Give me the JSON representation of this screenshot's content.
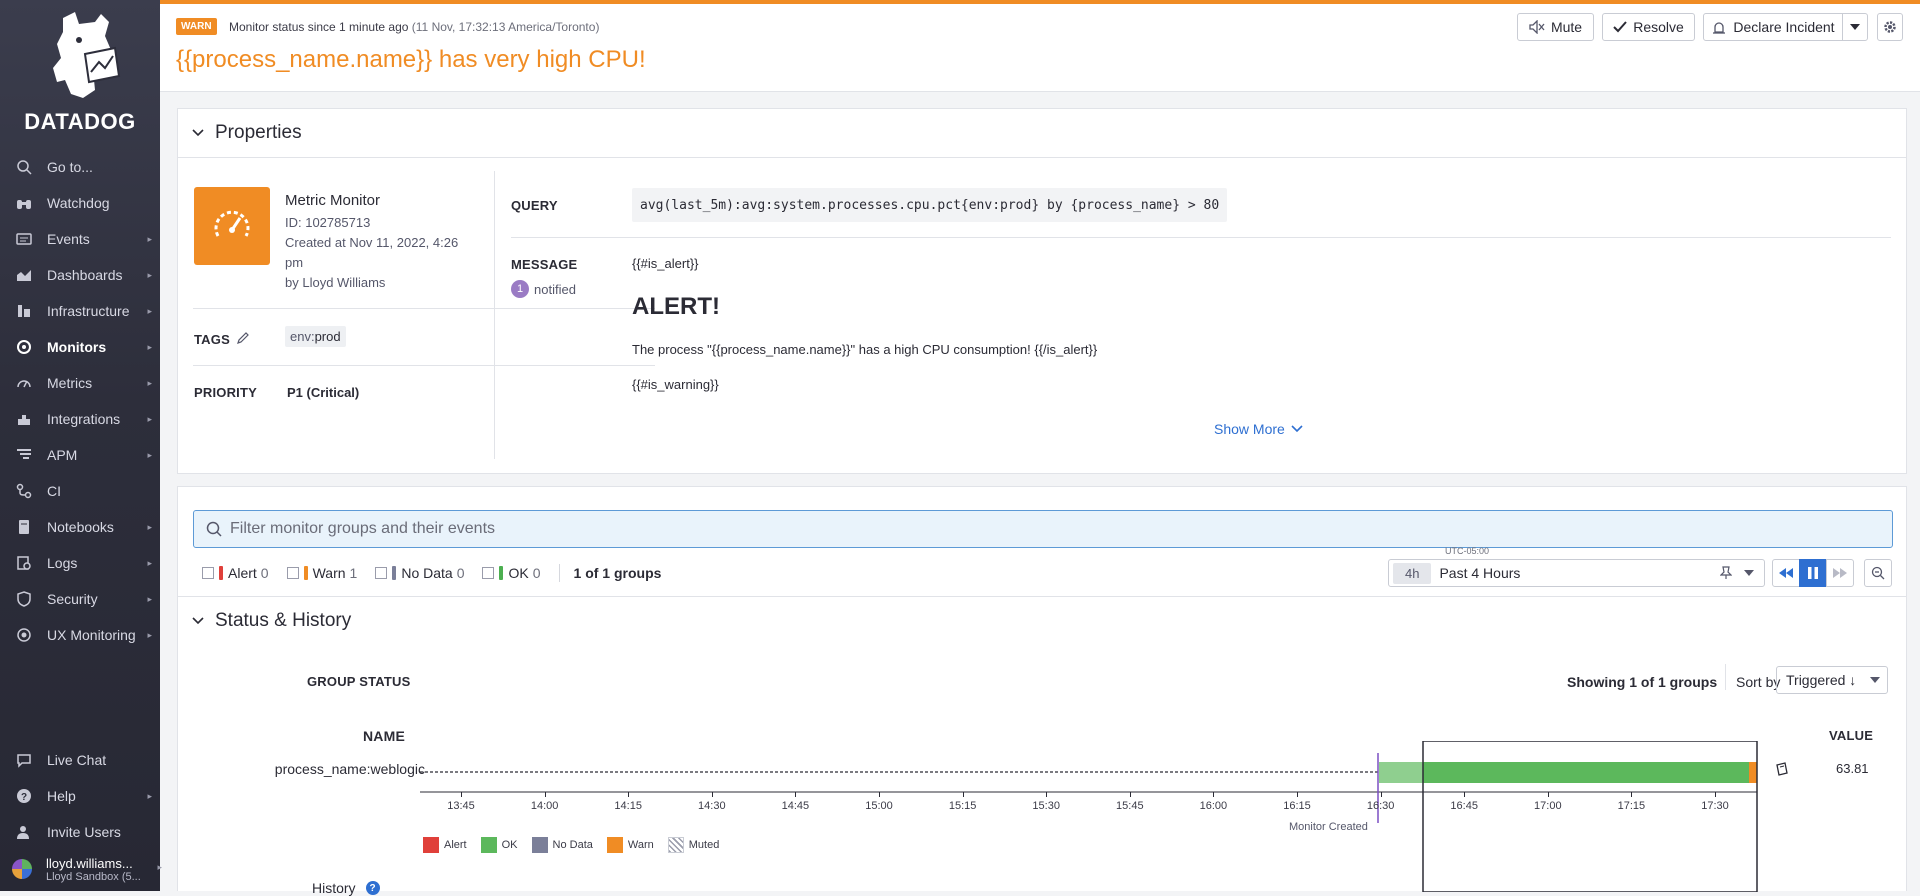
{
  "sidebar": {
    "logo_text": "DATADOG",
    "items": [
      {
        "label": "Go to...",
        "icon": "search-icon"
      },
      {
        "label": "Watchdog",
        "icon": "binoculars-icon"
      },
      {
        "label": "Events",
        "icon": "events-icon"
      },
      {
        "label": "Dashboards",
        "icon": "dashboards-icon"
      },
      {
        "label": "Infrastructure",
        "icon": "infrastructure-icon"
      },
      {
        "label": "Monitors",
        "icon": "monitors-icon"
      },
      {
        "label": "Metrics",
        "icon": "metrics-icon"
      },
      {
        "label": "Integrations",
        "icon": "integrations-icon"
      },
      {
        "label": "APM",
        "icon": "apm-icon"
      },
      {
        "label": "CI",
        "icon": "ci-icon"
      },
      {
        "label": "Notebooks",
        "icon": "notebooks-icon"
      },
      {
        "label": "Logs",
        "icon": "logs-icon"
      },
      {
        "label": "Security",
        "icon": "security-icon"
      },
      {
        "label": "UX Monitoring",
        "icon": "ux-monitoring-icon"
      }
    ],
    "bottom_items": [
      {
        "label": "Live Chat",
        "icon": "chat-icon"
      },
      {
        "label": "Help",
        "icon": "help-icon"
      },
      {
        "label": "Invite Users",
        "icon": "invite-users-icon"
      }
    ],
    "user": {
      "name": "lloyd.williams...",
      "org": "Lloyd Sandbox (5..."
    }
  },
  "header": {
    "badge": "WARN",
    "status_text": "Monitor status since 1 minute ago",
    "status_time": "(11 Nov, 17:32:13 America/Toronto)",
    "title": "{{process_name.name}} has very high CPU!",
    "buttons": {
      "mute": "Mute",
      "resolve": "Resolve",
      "declare": "Declare Incident"
    }
  },
  "properties": {
    "section_title": "Properties",
    "monitor_type": "Metric Monitor",
    "monitor_id": "ID: 102785713",
    "created_line1": "Created at Nov 11, 2022, 4:26",
    "created_line2": "pm",
    "created_by": "by Lloyd Williams",
    "tags_label": "TAGS",
    "tag_key": "env:",
    "tag_value": "prod",
    "priority_label": "PRIORITY",
    "priority_value": "P1 (Critical)",
    "query_label": "QUERY",
    "query": "avg(last_5m):avg:system.processes.cpu.pct{env:prod} by {process_name} > 80",
    "message_label": "MESSAGE",
    "notified_count": "1",
    "notified_label": "notified",
    "msg_line1": "{{#is_alert}}",
    "msg_heading": "ALERT!",
    "msg_line2": "The process \"{{process_name.name}}\" has a high CPU consumption! {{/is_alert}}",
    "msg_line3": "{{#is_warning}}",
    "show_more": "Show More"
  },
  "filters": {
    "search_placeholder": "Filter monitor groups and their events",
    "checks": [
      {
        "label": "Alert",
        "count": "0",
        "color": "#e0403a"
      },
      {
        "label": "Warn",
        "count": "1",
        "color": "#f08c24"
      },
      {
        "label": "No Data",
        "count": "0",
        "color": "#7b7f99"
      },
      {
        "label": "OK",
        "count": "0",
        "color": "#4caf50"
      }
    ],
    "groups_summary": "1 of 1 groups",
    "timezone": "UTC-05:00",
    "time_tag": "4h",
    "time_range": "Past 4 Hours"
  },
  "status_history": {
    "section_title": "Status & History",
    "group_status_label": "GROUP STATUS",
    "showing": "Showing 1 of 1 groups",
    "sort_by_label": "Sort by",
    "sort_value": "Triggered ↓",
    "name_header": "NAME",
    "value_header": "VALUE",
    "row_name": "process_name:weblogic",
    "row_value": "63.81",
    "ticks": [
      "13:45",
      "14:00",
      "14:15",
      "14:30",
      "14:45",
      "15:00",
      "15:15",
      "15:30",
      "15:45",
      "16:00",
      "16:15",
      "16:30",
      "16:45",
      "17:00",
      "17:15",
      "17:30"
    ],
    "monitor_created_label": "Monitor Created",
    "legend": [
      {
        "label": "Alert",
        "color": "#e0403a"
      },
      {
        "label": "OK",
        "color": "#5cb85c"
      },
      {
        "label": "No Data",
        "color": "#7b7f99"
      },
      {
        "label": "Warn",
        "color": "#f08c24"
      },
      {
        "label": "Muted",
        "color": "hatch"
      }
    ],
    "history_label": "History"
  },
  "colors": {
    "accent": "#f08c24",
    "ok": "#5cb85c",
    "link": "#2e6fd1"
  }
}
